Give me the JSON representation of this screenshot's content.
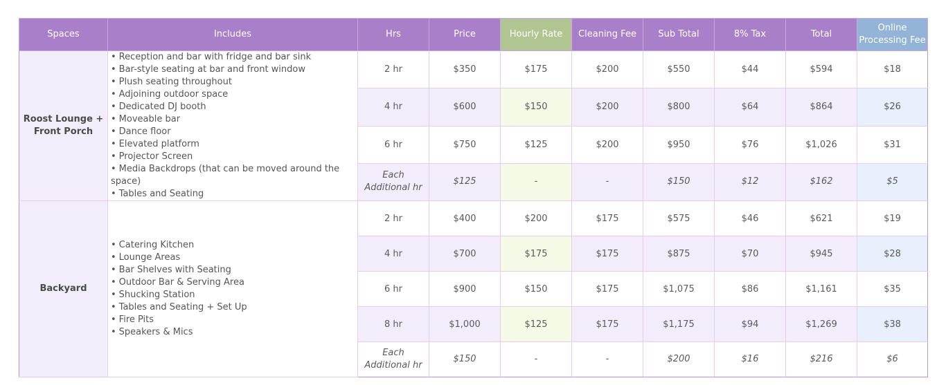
{
  "headers": {
    "spaces": "Spaces",
    "includes": "Includes",
    "hrs": "Hrs",
    "price": "Price",
    "hourly_rate": "Hourly Rate",
    "cleaning_fee": "Cleaning Fee",
    "sub_total": "Sub Total",
    "tax": "8% Tax",
    "total": "Total",
    "online_fee": "Online Processing Fee"
  },
  "colors": {
    "header_purple": "#a97fca",
    "header_green": "#b1c592",
    "header_blue": "#93b4d6",
    "row_shade_purple": "#f3ecfb",
    "row_shade_green": "#f4fae6",
    "row_shade_blue": "#e7f0fc"
  },
  "spaces": [
    {
      "name": "Roost Lounge + Front Porch",
      "features": [
        "Reception and bar with fridge and bar sink",
        "Bar-style seating at bar and front window",
        "Plush seating throughout",
        "Adjoining outdoor space",
        "Dedicated DJ booth",
        "Moveable bar",
        "Dance floor",
        "Elevated platform",
        "Projector Screen",
        "Media Backdrops (that can be moved around the space)",
        "Tables and Seating"
      ],
      "rows": [
        {
          "hrs": "2 hr",
          "price": "$350",
          "hourly_rate": "$175",
          "cleaning_fee": "$200",
          "sub_total": "$550",
          "tax": "$44",
          "total": "$594",
          "online_fee": "$18"
        },
        {
          "hrs": "4 hr",
          "price": "$600",
          "hourly_rate": "$150",
          "cleaning_fee": "$200",
          "sub_total": "$800",
          "tax": "$64",
          "total": "$864",
          "online_fee": "$26"
        },
        {
          "hrs": "6 hr",
          "price": "$750",
          "hourly_rate": "$125",
          "cleaning_fee": "$200",
          "sub_total": "$950",
          "tax": "$76",
          "total": "$1,026",
          "online_fee": "$31"
        },
        {
          "hrs": "Each Additional hr",
          "price": "$125",
          "hourly_rate": "-",
          "cleaning_fee": "-",
          "sub_total": "$150",
          "tax": "$12",
          "total": "$162",
          "online_fee": "$5"
        }
      ]
    },
    {
      "name": "Backyard",
      "features": [
        "Catering Kitchen",
        "Lounge Areas",
        "Bar Shelves with Seating",
        "Outdoor Bar & Serving Area",
        "Shucking Station",
        "Tables and Seating + Set Up",
        "Fire Pits",
        "Speakers & Mics"
      ],
      "rows": [
        {
          "hrs": "2 hr",
          "price": "$400",
          "hourly_rate": "$200",
          "cleaning_fee": "$175",
          "sub_total": "$575",
          "tax": "$46",
          "total": "$621",
          "online_fee": "$19"
        },
        {
          "hrs": "4 hr",
          "price": "$700",
          "hourly_rate": "$175",
          "cleaning_fee": "$175",
          "sub_total": "$875",
          "tax": "$70",
          "total": "$945",
          "online_fee": "$28"
        },
        {
          "hrs": "6 hr",
          "price": "$900",
          "hourly_rate": "$150",
          "cleaning_fee": "$175",
          "sub_total": "$1,075",
          "tax": "$86",
          "total": "$1,161",
          "online_fee": "$35"
        },
        {
          "hrs": "8 hr",
          "price": "$1,000",
          "hourly_rate": "$125",
          "cleaning_fee": "$175",
          "sub_total": "$1,175",
          "tax": "$94",
          "total": "$1,269",
          "online_fee": "$38"
        },
        {
          "hrs": "Each Additional hr",
          "price": "$150",
          "hourly_rate": "-",
          "cleaning_fee": "-",
          "sub_total": "$200",
          "tax": "$16",
          "total": "$216",
          "online_fee": "$6"
        }
      ]
    }
  ]
}
